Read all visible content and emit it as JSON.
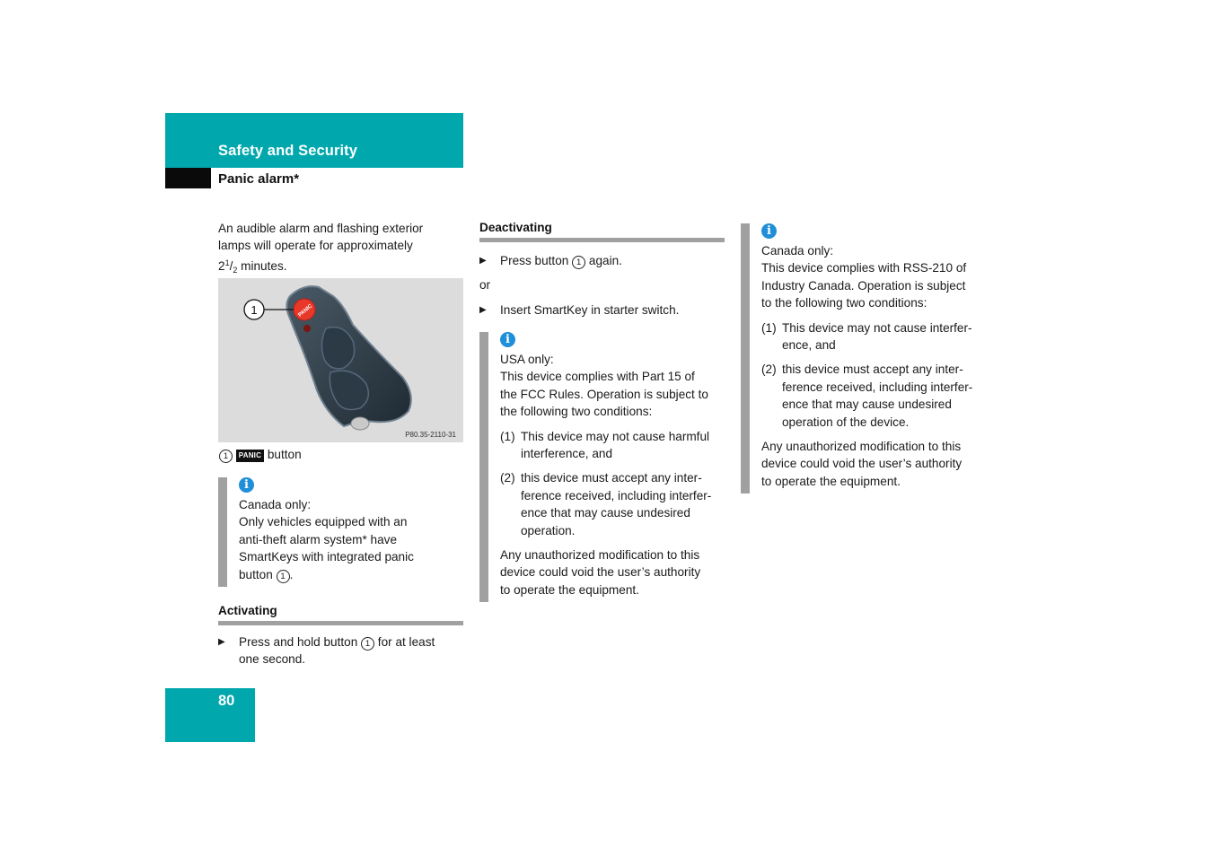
{
  "header": {
    "section_title": "Safety and Security",
    "subsection_title": "Panic alarm*"
  },
  "colors": {
    "brand_teal": "#00a8ad",
    "rule_gray": "#a0a0a0",
    "info_blue": "#1e8fd8"
  },
  "column1": {
    "intro_line1": "An audible alarm and flashing exterior",
    "intro_line2": "lamps will operate for approximately",
    "intro_whole": "2",
    "intro_num": "1",
    "intro_slash": "/",
    "intro_den": "2",
    "intro_tail": " minutes.",
    "figure": {
      "callout": "1",
      "panic_label": "PANIC",
      "code": "P80.35-2110-31"
    },
    "caption": {
      "number": "1",
      "badge": "PANIC",
      "text": "button"
    },
    "info": {
      "icon": "info-icon",
      "heading": "Canada only:",
      "lines": [
        "Only vehicles equipped with an",
        "anti-theft alarm system* have",
        "SmartKeys with integrated panic"
      ],
      "last_prefix": "button ",
      "last_ref": "1",
      "last_suffix": "."
    },
    "activating": {
      "heading": "Activating",
      "step_prefix": "Press and hold button ",
      "step_ref": "1",
      "step_suffix": " for at least",
      "step_line2": "one second."
    }
  },
  "column2": {
    "deactivating": {
      "heading": "Deactivating",
      "step1_prefix": "Press button ",
      "step1_ref": "1",
      "step1_suffix": " again.",
      "or": "or",
      "step2": "Insert SmartKey in starter switch."
    },
    "info": {
      "heading": "USA only:",
      "lines": [
        "This device complies with Part 15 of",
        "the FCC Rules. Operation is subject to",
        "the following two conditions:"
      ],
      "conditions": [
        {
          "num": "(1)",
          "lines": [
            "This device may not cause harmful",
            "interference, and"
          ]
        },
        {
          "num": "(2)",
          "lines": [
            "this device must accept any inter-",
            "ference received, including interfer-",
            "ence that may cause undesired",
            "operation."
          ]
        }
      ],
      "closing": [
        "Any unauthorized modification to this",
        "device could void the user’s authority",
        "to operate the equipment."
      ]
    }
  },
  "column3": {
    "info": {
      "heading": "Canada only:",
      "lines": [
        "This device complies with RSS-210 of",
        "Industry Canada. Operation is subject",
        "to the following two conditions:"
      ],
      "conditions": [
        {
          "num": "(1)",
          "lines": [
            "This device may not cause interfer-",
            "ence, and"
          ]
        },
        {
          "num": "(2)",
          "lines": [
            "this device must accept any inter-",
            "ference received, including interfer-",
            "ence that may cause undesired",
            "operation of the device."
          ]
        }
      ],
      "closing": [
        "Any unauthorized modification to this",
        "device could void the user’s authority",
        "to operate the equipment."
      ]
    }
  },
  "footer": {
    "page_number": "80"
  }
}
